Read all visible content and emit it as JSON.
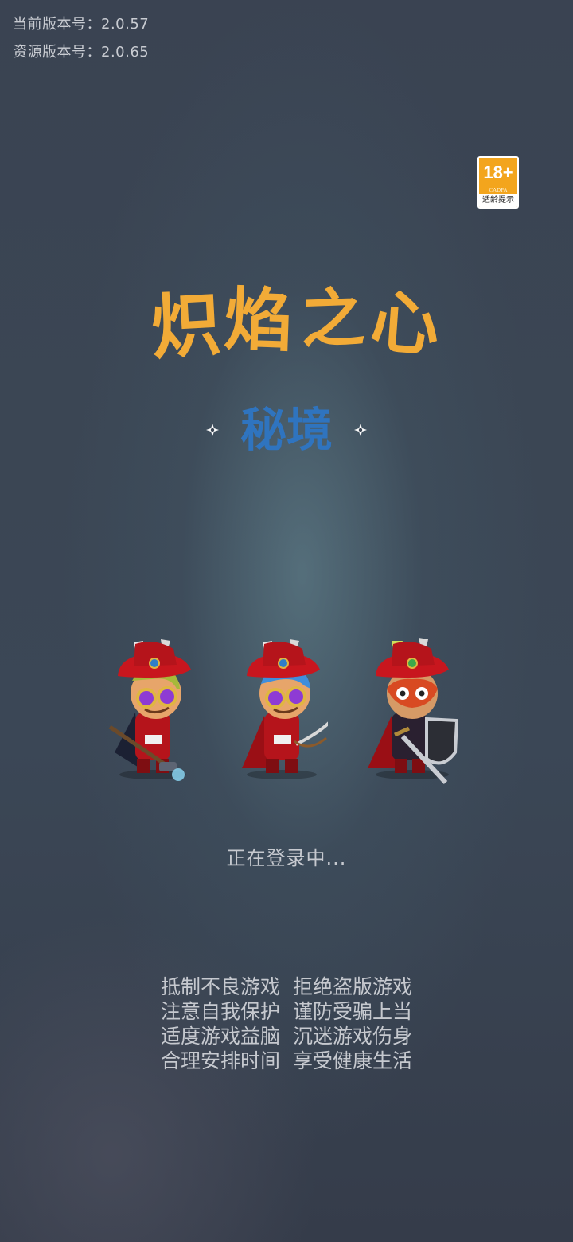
{
  "version_info": {
    "current_version": "当前版本号：2.0.57",
    "resource_version": "资源版本号：2.0.65"
  },
  "age_rating": {
    "age": "18+",
    "org": "CADPA",
    "tip": "适龄提示"
  },
  "game_title": "炽焰之心",
  "game_subtitle": "秘境",
  "heroes": [
    {
      "name_icon": "hero-mage-icon"
    },
    {
      "name_icon": "hero-archer-icon"
    },
    {
      "name_icon": "hero-warrior-icon"
    }
  ],
  "status_text": "正在登录中...",
  "health_notice": [
    [
      "抵制不良游戏",
      "拒绝盗版游戏"
    ],
    [
      "注意自我保护",
      "谨防受骗上当"
    ],
    [
      "适度游戏益脑",
      "沉迷游戏伤身"
    ],
    [
      "合理安排时间",
      "享受健康生活"
    ]
  ],
  "colors": {
    "title": "#f2ab37",
    "subtitle": "#2f74bf",
    "age_badge": "#f3a51d",
    "hero_red": "#b5141b"
  }
}
